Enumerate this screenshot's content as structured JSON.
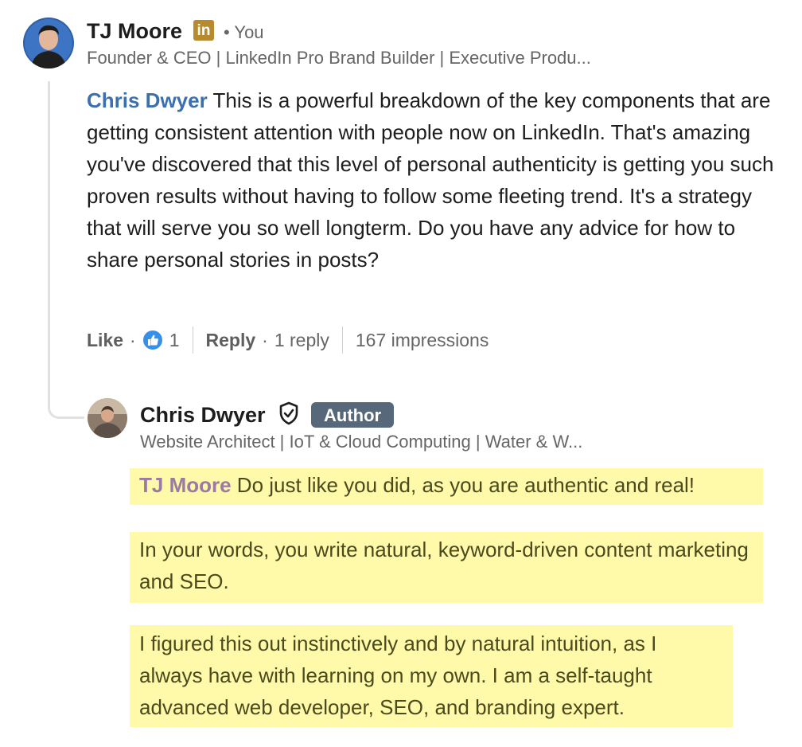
{
  "comment": {
    "author_name": "TJ Moore",
    "linkedin_badge": "in",
    "you_label": "• You",
    "headline": "Founder & CEO | LinkedIn Pro Brand Builder | Executive Produ...",
    "mention": "Chris Dwyer",
    "text": " This is a powerful breakdown of the key components that are getting consistent attention with people now on LinkedIn. That's amazing you've discovered that this level of personal authenticity is getting you such proven results without having to follow some fleeting trend. It's a strategy that will serve you so well longterm. Do you have any advice for how to share personal stories in posts?",
    "like_label": "Like",
    "like_count": "1",
    "reply_label": "Reply",
    "reply_count": "1 reply",
    "impressions": "167 impressions"
  },
  "reply": {
    "author_name": "Chris Dwyer",
    "author_badge": "Author",
    "headline": "Website Architect | IoT & Cloud Computing | Water & W...",
    "mention": "TJ Moore",
    "paragraph1": " Do just like you did, as you are authentic and real!",
    "paragraph2": "In your words, you write natural, keyword-driven content marketing and SEO.",
    "paragraph3": "I figured this out instinctively and by natural intuition, as I always have with learning on my own. I am a self-taught advanced web developer, SEO, and branding expert."
  },
  "icons": {
    "verified": "shield-check-icon",
    "reaction": "thumbs-up-icon",
    "linkedin": "linkedin-icon"
  },
  "colors": {
    "mention": "#3a6fb0",
    "highlight": "#fefaa9",
    "author_badge": "#56687a",
    "linkedin_badge": "#b88a2e"
  }
}
